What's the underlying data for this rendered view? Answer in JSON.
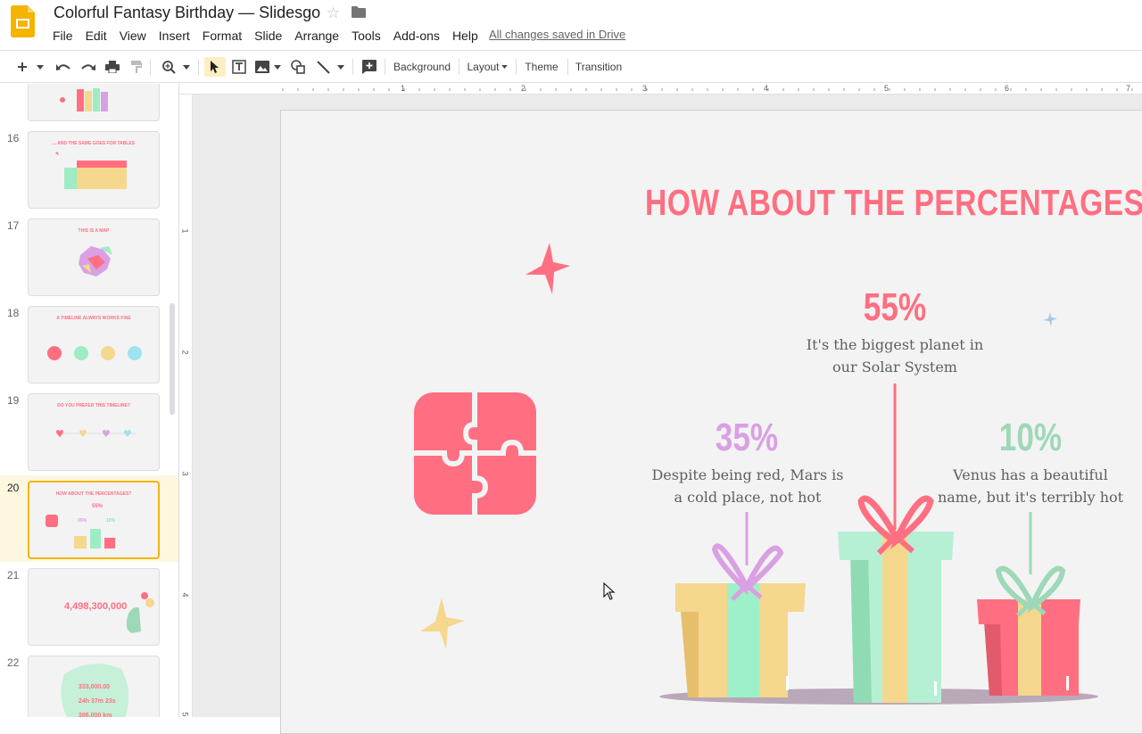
{
  "doc": {
    "title": "Colorful Fantasy Birthday — Slidesgo",
    "saved_status": "All changes saved in Drive"
  },
  "menu": [
    "File",
    "Edit",
    "View",
    "Insert",
    "Format",
    "Slide",
    "Arrange",
    "Tools",
    "Add-ons",
    "Help"
  ],
  "toolbar": {
    "background_label": "Background",
    "layout_label": "Layout",
    "theme_label": "Theme",
    "transition_label": "Transition"
  },
  "filmstrip": {
    "slides": [
      {
        "num": "16",
        "title": "... AND THE SAME GOES FOR TABLES"
      },
      {
        "num": "17",
        "title": "THIS IS A MAP"
      },
      {
        "num": "18",
        "title": "A TIMELINE ALWAYS WORKS FINE"
      },
      {
        "num": "19",
        "title": "DO YOU PREFER THIS TIMELINE?"
      },
      {
        "num": "20",
        "title": "HOW ABOUT THE PERCENTAGES?"
      },
      {
        "num": "21",
        "title": "4,498,300,000"
      },
      {
        "num": "22",
        "title": "333,000.00"
      }
    ],
    "active": "20"
  },
  "ruler": {
    "top": [
      "1",
      "2",
      "3",
      "4",
      "5",
      "6",
      "7"
    ],
    "left": [
      "1",
      "2",
      "3",
      "4",
      "5"
    ]
  },
  "slide": {
    "title": "HOW ABOUT THE PERCENTAGES?",
    "stats": [
      {
        "value": "55%",
        "line1": "It's the biggest planet in",
        "line2": "our Solar System",
        "color": "#ff6f81"
      },
      {
        "value": "35%",
        "line1": "Despite being red, Mars is",
        "line2": "a cold place, not hot",
        "color": "#d9a0e4"
      },
      {
        "value": "10%",
        "line1": "Venus has a beautiful",
        "line2": "name, but it's terribly hot",
        "color": "#9ed8b8"
      }
    ]
  },
  "colors": {
    "pink": "#ff6f81",
    "yellow": "#f5d78e",
    "mint": "#9eecc4",
    "lilac": "#d9a0e4",
    "selected_tool": "#feefc3",
    "active_thumb": "#f4b400"
  }
}
